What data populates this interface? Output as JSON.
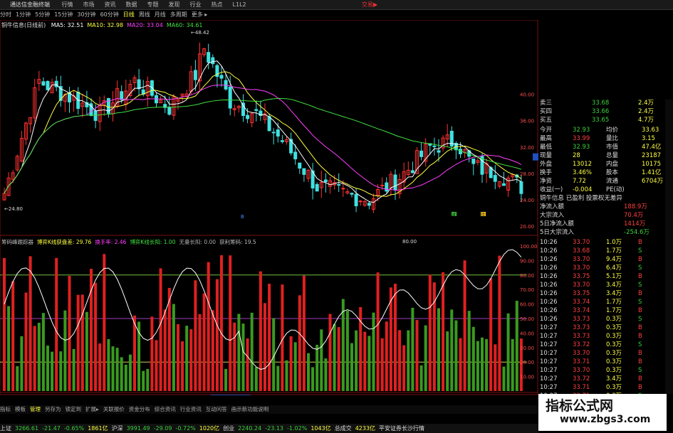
{
  "window": {
    "app_title": "通达信金融终端",
    "menu": [
      "行情",
      "市场",
      "资讯",
      "数据",
      "专题",
      "发现",
      "行业",
      "热点",
      "L1L2"
    ],
    "trade_link": "交易▶"
  },
  "period_bar": {
    "items": [
      "分时",
      "1分钟",
      "5分钟",
      "15分钟",
      "30分钟",
      "60分钟",
      "日线",
      "周线",
      "月线",
      "多周期",
      "更多 ▸"
    ],
    "active_index": 6
  },
  "main_chart": {
    "stock_label": "铜牛信息(日线前)",
    "ma_legends": [
      {
        "label": "MA5: 32.51",
        "color": "#ffffff"
      },
      {
        "label": "MA10: 32.98",
        "color": "#ffff40"
      },
      {
        "label": "MA20: 33.04",
        "color": "#ff40ff"
      },
      {
        "label": "MA60: 34.61",
        "color": "#40e040"
      }
    ],
    "high_label": "48.42",
    "low_label": "24.80",
    "price_axis": [
      "40.00",
      "36.00",
      "32.00",
      "28.00",
      "24.00",
      "20.00"
    ],
    "current_price_tag": "30.50",
    "ma_colors": {
      "ma5": "#ffffff",
      "ma10": "#ffff40",
      "ma20": "#ff40ff",
      "ma60": "#40e040"
    }
  },
  "oscillator": {
    "legends": [
      {
        "label": "筹码峰跟踪器",
        "color": "#bbbbbb"
      },
      {
        "label": "博弈K线获盘差: 29.76",
        "color": "#ffff40"
      },
      {
        "label": "换手率: 2.46",
        "color": "#ff40ff"
      },
      {
        "label": "博弈K线长阳: 1.00",
        "color": "#40e040"
      },
      {
        "label": "无量长阳: 0.00",
        "color": "#aaaaaa"
      },
      {
        "label": "获利筹码: 19.5",
        "color": "#bbbbbb"
      }
    ],
    "right_value": "80.00",
    "axis": [
      "100.00",
      "90.00",
      "80.00",
      "70.00",
      "60.00",
      "50.00",
      "40.00",
      "30.00",
      "20.00",
      "10.00"
    ],
    "signal_buy": "减",
    "signal_sell": "持",
    "mid_marker": "B"
  },
  "date_axis": {
    "labels": [
      "2023年",
      "2023/04/14/五",
      "5",
      "6",
      "8"
    ]
  },
  "quote_panel": {
    "asks": [
      {
        "label": "卖三",
        "price": "33.68",
        "vol": "2.4万"
      },
      {
        "label": "买四",
        "price": "33.66",
        "vol": "2.4万"
      },
      {
        "label": "买五",
        "price": "33.65",
        "vol": "4.7万"
      }
    ],
    "stats": [
      {
        "k1": "今开",
        "v1": "32.93",
        "k2": "均价",
        "v2": "33.63"
      },
      {
        "k1": "最高",
        "v1": "33.99",
        "k2": "量比",
        "v2": "3.15"
      },
      {
        "k1": "最低",
        "v1": "32.93",
        "k2": "市值",
        "v2": "47.4亿"
      },
      {
        "k1": "现量",
        "v1": "28",
        "k2": "总量",
        "v2": "23187"
      },
      {
        "k1": "外盘",
        "v1": "13012",
        "k2": "内盘",
        "v2": "10175"
      },
      {
        "k1": "换手",
        "v1": "3.46%",
        "k2": "股本",
        "v2": "1.41亿"
      },
      {
        "k1": "净资",
        "v1": "7.72",
        "k2": "流通",
        "v2": "6704万"
      },
      {
        "k1": "收益(一)",
        "v1": "-0.004",
        "k2": "PE(动)",
        "v2": ""
      }
    ],
    "info_tabs": "铜牛信息 已盈利 投票权无差异",
    "flows": [
      {
        "label": "净流入额",
        "value": "188.9万"
      },
      {
        "label": "大宗流入",
        "value": "70.4万"
      },
      {
        "label": "5日净流入额",
        "value": "1414万"
      },
      {
        "label": "5日大宗流入",
        "value": "-254.6万"
      }
    ],
    "ticks": [
      {
        "time": "10:26",
        "price": "33.70",
        "vol": "1.0万",
        "bs": "B"
      },
      {
        "time": "10:26",
        "price": "33.68",
        "vol": "1.7万",
        "bs": "S"
      },
      {
        "time": "10:26",
        "price": "33.70",
        "vol": "9.4万",
        "bs": "B"
      },
      {
        "time": "10:26",
        "price": "33.70",
        "vol": "6.4万",
        "bs": "S"
      },
      {
        "time": "10:26",
        "price": "33.75",
        "vol": "5.1万",
        "bs": "B"
      },
      {
        "time": "10:26",
        "price": "33.70",
        "vol": "3.4万",
        "bs": "S"
      },
      {
        "time": "10:26",
        "price": "33.75",
        "vol": "3.4万",
        "bs": "B"
      },
      {
        "time": "10:26",
        "price": "33.74",
        "vol": "1.7万",
        "bs": "S"
      },
      {
        "time": "10:26",
        "price": "33.74",
        "vol": "1.7万",
        "bs": "B"
      },
      {
        "time": "10:26",
        "price": "33.73",
        "vol": "0.3万",
        "bs": "S"
      },
      {
        "time": "10:27",
        "price": "33.73",
        "vol": "0.3万",
        "bs": "B"
      },
      {
        "time": "10:27",
        "price": "33.73",
        "vol": "0.3万",
        "bs": "B"
      },
      {
        "time": "10:27",
        "price": "33.72",
        "vol": "0.3万",
        "bs": "S"
      },
      {
        "time": "10:27",
        "price": "33.70",
        "vol": "0.3万",
        "bs": "B"
      },
      {
        "time": "10:27",
        "price": "33.71",
        "vol": "0.3万",
        "bs": "B"
      },
      {
        "time": "10:27",
        "price": "33.70",
        "vol": "0.3万",
        "bs": "S"
      },
      {
        "time": "10:27",
        "price": "33.72",
        "vol": "3.4万",
        "bs": "B"
      },
      {
        "time": "10:27",
        "price": "33.71",
        "vol": "0.3万",
        "bs": "B"
      },
      {
        "time": "10:27",
        "price": "33.71",
        "vol": "0.3万",
        "bs": "S"
      },
      {
        "time": "10:27",
        "price": "33.72",
        "vol": "0.3万",
        "bs": "S"
      }
    ]
  },
  "bottom_tabs": {
    "items": [
      "指标",
      "模板",
      "管理",
      "另存为",
      "锁定到"
    ],
    "active_index": 2,
    "subtabs": [
      "扩展▸",
      "关联报价",
      "资金分布",
      "综合资讯",
      "行业资讯",
      "互动问答",
      "画示新功能说明"
    ]
  },
  "index_bar": [
    {
      "name": "上证",
      "value": "3266.61",
      "chg": "-21.47",
      "pct": "-0.65%",
      "amt": "1861亿"
    },
    {
      "name": "沪深",
      "value": "3991.49",
      "chg": "-29.09",
      "pct": "-0.72%",
      "amt": "1020亿"
    },
    {
      "name": "创业",
      "value": "2240.24",
      "chg": "-23.13",
      "pct": "-1.02%",
      "amt": "1043亿"
    }
  ],
  "index_tail": {
    "label": "总成交",
    "amt": "4233亿",
    "broker": "平安证券长沙行情"
  },
  "watermark": {
    "line1": "指标公式网",
    "line2": "www.zbgs3.com"
  }
}
